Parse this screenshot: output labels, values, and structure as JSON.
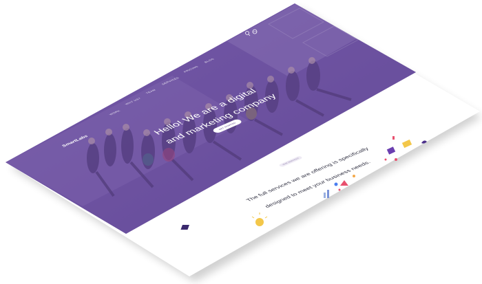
{
  "site": {
    "logo": "SmartLabs",
    "nav": [
      "WORK",
      "WHY US?",
      "TEAM",
      "SERVICES",
      "PRICING",
      "BLOG"
    ],
    "header_icons": [
      "search-icon",
      "globe-icon"
    ]
  },
  "hero": {
    "headline_line1": "Hello! We are a digital",
    "headline_line2": "and marketing company",
    "cta_label": "GET STARTED"
  },
  "services_section": {
    "tag": "OUR SERVICES",
    "description_line1": "The full services we are offering is specifically",
    "description_line2": "designed to meet your business needs."
  },
  "colors": {
    "hero_overlay": "#6b4f9e",
    "accent": "#5b3c8c",
    "page_bg": "#ffffff"
  }
}
